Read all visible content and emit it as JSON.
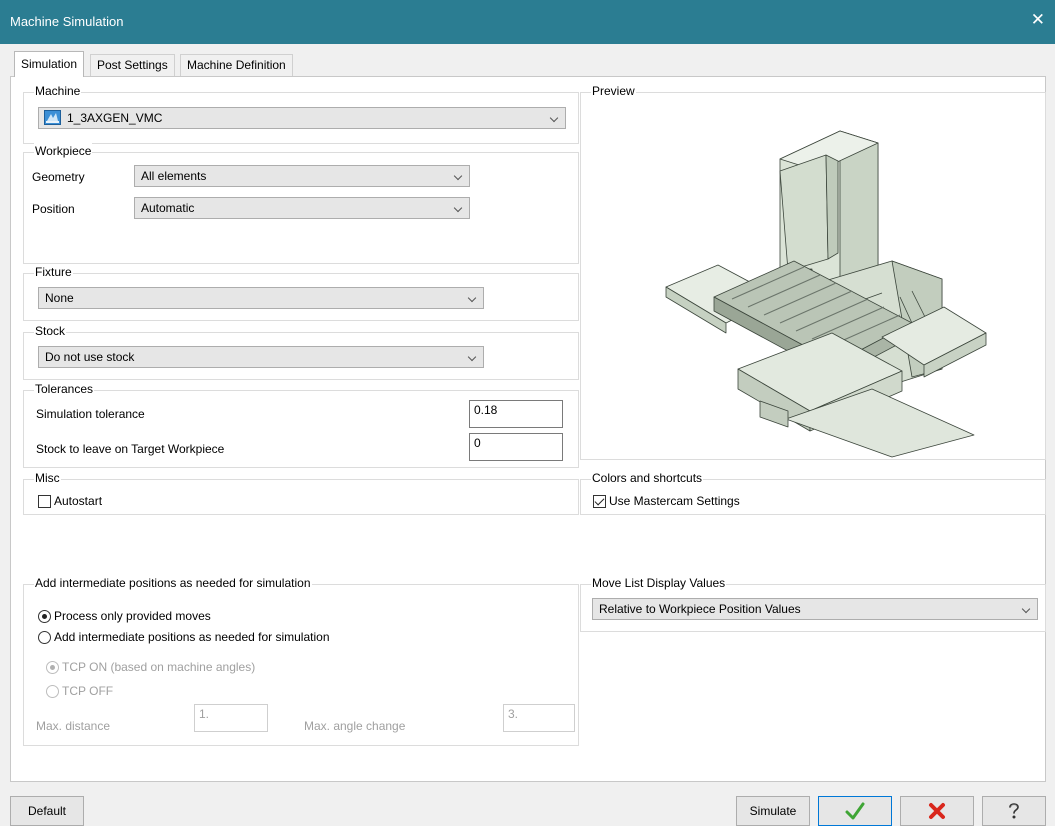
{
  "window": {
    "title": "Machine Simulation",
    "close_glyph": "✕"
  },
  "tabs": [
    {
      "label": "Simulation",
      "active": true
    },
    {
      "label": "Post Settings",
      "active": false
    },
    {
      "label": "Machine Definition",
      "active": false
    }
  ],
  "machine": {
    "group_label": "Machine",
    "selected": "1_3AXGEN_VMC",
    "icon": "machine-icon"
  },
  "workpiece": {
    "group_label": "Workpiece",
    "geometry_label": "Geometry",
    "geometry_value": "All elements",
    "position_label": "Position",
    "position_value": "Automatic"
  },
  "fixture": {
    "group_label": "Fixture",
    "selected": "None"
  },
  "stock": {
    "group_label": "Stock",
    "selected": "Do not use stock"
  },
  "tolerances": {
    "group_label": "Tolerances",
    "sim_tol_label": "Simulation tolerance",
    "sim_tol_value": "0.18",
    "stock_leave_label": "Stock to leave on Target Workpiece",
    "stock_leave_value": "0"
  },
  "misc": {
    "group_label": "Misc",
    "autostart_label": "Autostart",
    "autostart_checked": false
  },
  "preview": {
    "group_label": "Preview"
  },
  "colors": {
    "group_label": "Colors and shortcuts",
    "use_mastercam_label": "Use Mastercam Settings",
    "use_mastercam_checked": true
  },
  "intermediate": {
    "group_label": "Add intermediate positions as needed for simulation",
    "opt_process_label": "Process only provided moves",
    "opt_add_label": "Add intermediate positions as needed for simulation",
    "tcp_on_label": "TCP ON (based on machine angles)",
    "tcp_off_label": "TCP OFF",
    "max_distance_label": "Max. distance",
    "max_distance_value": "1.",
    "max_angle_label": "Max. angle change",
    "max_angle_value": "3."
  },
  "move_list": {
    "group_label": "Move List Display Values",
    "selected": "Relative to Workpiece Position Values"
  },
  "buttons": {
    "default_label": "Default",
    "simulate_label": "Simulate",
    "ok_icon": "checkmark-icon",
    "cancel_icon": "red-x-icon",
    "help_icon": "help-icon"
  },
  "colors_palette": {
    "title_bar": "#2b7d92",
    "ok_green": "#3fa535",
    "cancel_red": "#d9271c",
    "machine_body": "#dfe8dc"
  }
}
